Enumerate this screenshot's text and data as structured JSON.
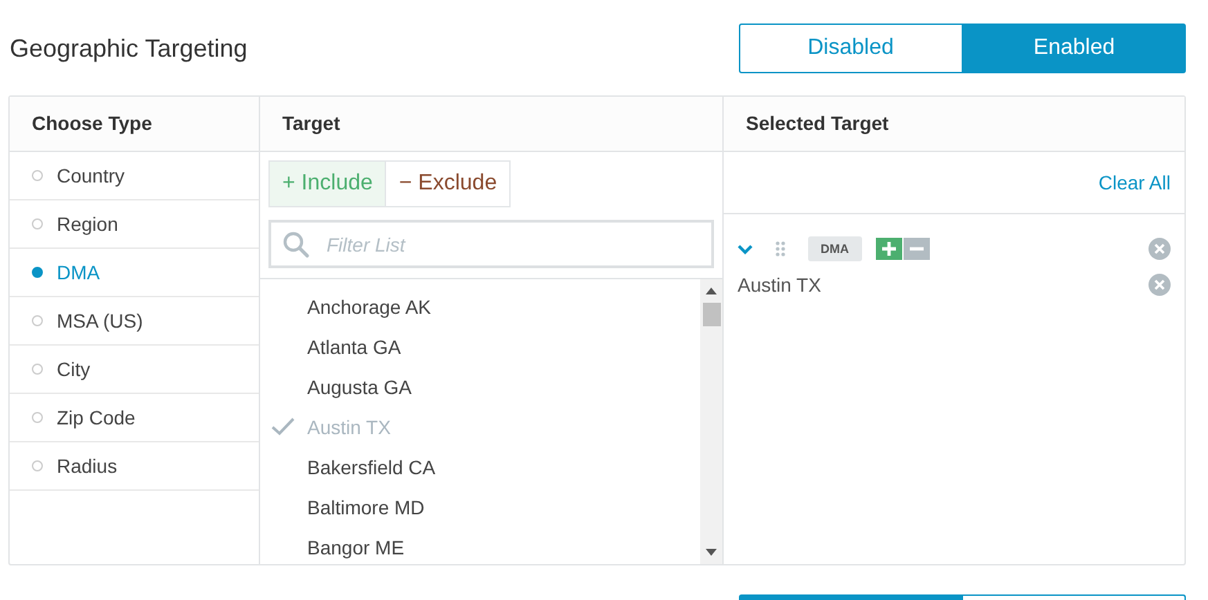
{
  "title": "Geographic Targeting",
  "toggle": [
    {
      "label": "Disabled",
      "selected": false
    },
    {
      "label": "Enabled",
      "selected": true
    }
  ],
  "columns": {
    "choose_type": "Choose Type",
    "target": "Target",
    "selected_target": "Selected Target"
  },
  "types": [
    {
      "label": "Country",
      "selected": false
    },
    {
      "label": "Region",
      "selected": false
    },
    {
      "label": "DMA",
      "selected": true
    },
    {
      "label": "MSA (US)",
      "selected": false
    },
    {
      "label": "City",
      "selected": false
    },
    {
      "label": "Zip Code",
      "selected": false
    },
    {
      "label": "Radius",
      "selected": false
    }
  ],
  "modes": [
    {
      "kind": "include",
      "label": "+ Include",
      "selected": true
    },
    {
      "kind": "exclude",
      "label": "− Exclude",
      "selected": false
    }
  ],
  "filter": {
    "placeholder": "Filter List"
  },
  "targets": [
    {
      "label": "Anchorage AK",
      "checked": false
    },
    {
      "label": "Atlanta GA",
      "checked": false
    },
    {
      "label": "Augusta GA",
      "checked": false
    },
    {
      "label": "Austin TX",
      "checked": true
    },
    {
      "label": "Bakersfield CA",
      "checked": false
    },
    {
      "label": "Baltimore MD",
      "checked": false
    },
    {
      "label": "Bangor ME",
      "checked": false
    }
  ],
  "clear_all": "Clear All",
  "groups": [
    {
      "type": "DMA",
      "expanded": true,
      "include": true,
      "items": [
        "Austin TX"
      ]
    }
  ]
}
